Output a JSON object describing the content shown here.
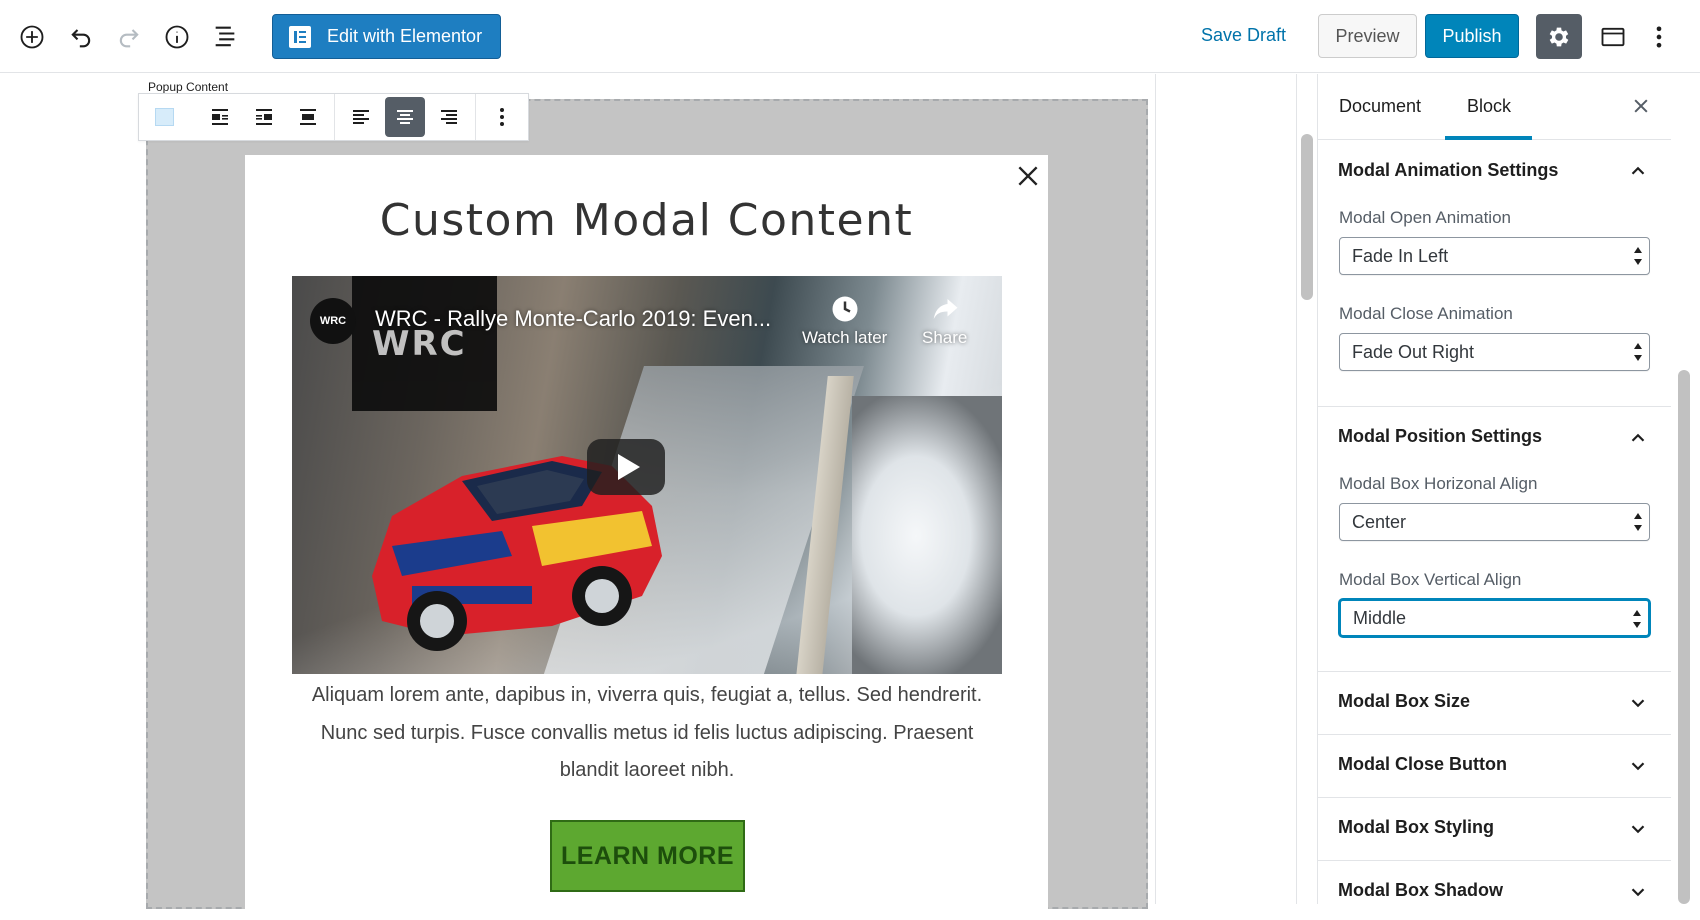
{
  "toolbar": {
    "edit_elementor_label": "Edit with Elementor",
    "save_draft_label": "Save Draft",
    "preview_label": "Preview",
    "publish_label": "Publish"
  },
  "editor": {
    "block_label": "Popup Content",
    "modal_title": "Custom Modal Content",
    "video": {
      "title": "WRC - Rallye Monte-Carlo 2019: Even...",
      "channel_logo_text": "WRC",
      "channel_avatar_text": "WRC",
      "watch_later_label": "Watch later",
      "share_label": "Share"
    },
    "body_text": "Aliquam lorem ante, dapibus in, viverra quis, feugiat a, tellus. Sed hendrerit. Nunc sed turpis. Fusce convallis metus id felis luctus adipiscing. Praesent blandit laoreet nibh.",
    "button_label": "LEARN MORE"
  },
  "sidebar": {
    "tabs": [
      {
        "label": "Document",
        "active": false
      },
      {
        "label": "Block",
        "active": true
      }
    ],
    "panels": [
      {
        "title": "Modal Animation Settings",
        "expanded": true,
        "fields": [
          {
            "label": "Modal Open Animation",
            "value": "Fade In Left"
          },
          {
            "label": "Modal Close Animation",
            "value": "Fade Out Right"
          }
        ]
      },
      {
        "title": "Modal Position Settings",
        "expanded": true,
        "fields": [
          {
            "label": "Modal Box Horizonal Align",
            "value": "Center"
          },
          {
            "label": "Modal Box Vertical Align",
            "value": "Middle"
          }
        ]
      },
      {
        "title": "Modal Box Size",
        "expanded": false
      },
      {
        "title": "Modal Close Button",
        "expanded": false
      },
      {
        "title": "Modal Box Styling",
        "expanded": false
      },
      {
        "title": "Modal Box Shadow",
        "expanded": false
      }
    ]
  },
  "colors": {
    "primary": "#0085ba",
    "elementor": "#1e7ec1",
    "button_green": "#5da830"
  }
}
